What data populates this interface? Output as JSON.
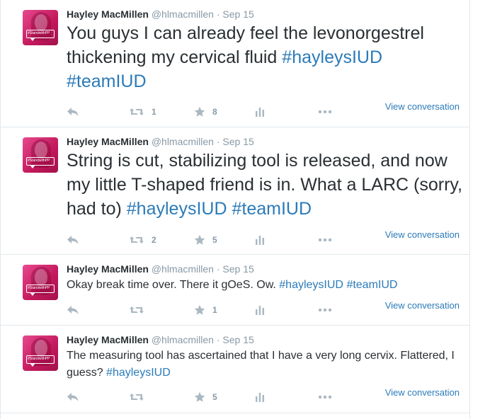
{
  "tweets": [
    {
      "name": "Hayley MacMillen",
      "handle": "@hlmacmillen",
      "separator": "·",
      "time": "Sep 15",
      "text_parts": [
        "You guys I can already feel the levonorgestrel thickening my cervical fluid ",
        "#hayleysIUD",
        " ",
        "#teamIUD"
      ],
      "retweets": "1",
      "favorites": "8",
      "view_conversation": "View conversation"
    },
    {
      "name": "Hayley MacMillen",
      "handle": "@hlmacmillen",
      "separator": "·",
      "time": "Sep 15",
      "text_parts": [
        "String is cut, stabilizing tool is released, and now my little T-shaped friend is in. What a LARC (sorry, had to) ",
        "#hayleysIUD",
        " ",
        "#teamIUD"
      ],
      "retweets": "2",
      "favorites": "5",
      "view_conversation": "View conversation"
    },
    {
      "name": "Hayley MacMillen",
      "handle": "@hlmacmillen",
      "separator": "·",
      "time": "Sep 15",
      "text_parts": [
        "Okay break time over. There it gOeS. Ow. ",
        "#hayleysIUD",
        " ",
        "#teamIUD"
      ],
      "retweets": "",
      "favorites": "1",
      "view_conversation": "View conversation"
    },
    {
      "name": "Hayley MacMillen",
      "handle": "@hlmacmillen",
      "separator": "·",
      "time": "Sep 15",
      "text_parts": [
        "The measuring tool has ascertained that I have a very long cervix. Flattered, I guess? ",
        "#hayleysIUD",
        "",
        ""
      ],
      "retweets": "",
      "favorites": "5",
      "view_conversation": "View conversation"
    }
  ],
  "avatar_badge_text": "#StandwithPP",
  "colors": {
    "hashtag": "#2b7bb9",
    "muted": "#8899a6",
    "icon": "#aab8c2",
    "avatar": "#e8498f"
  },
  "icons": [
    "reply-icon",
    "retweet-icon",
    "favorite-icon",
    "stats-icon",
    "more-icon"
  ]
}
